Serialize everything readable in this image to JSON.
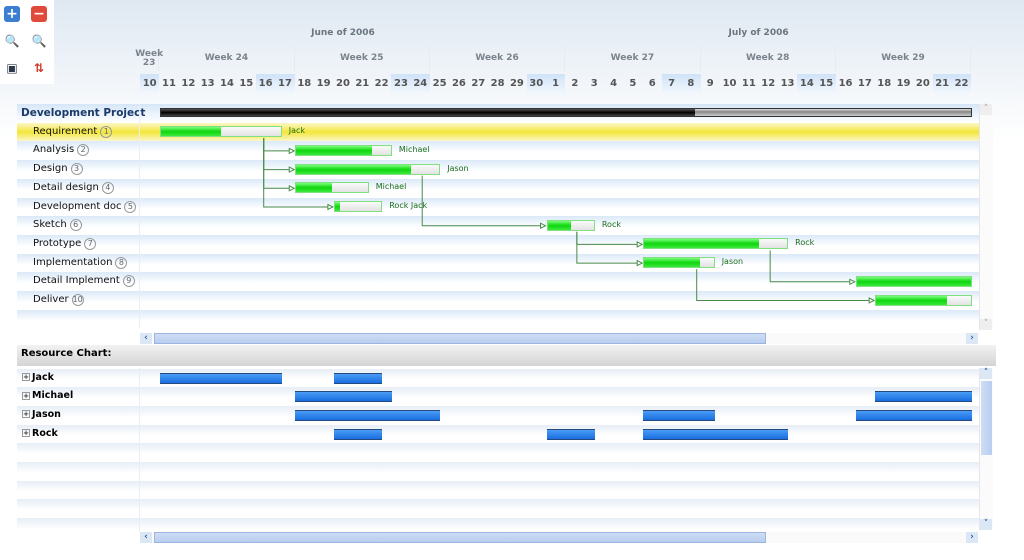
{
  "toolbar": [
    {
      "icon": "zoom-in-plus-icon",
      "glyph": "+",
      "color": "#3a7fd0"
    },
    {
      "icon": "minus-icon",
      "glyph": "−",
      "color": "#e04a3a"
    },
    {
      "icon": "magnifier-zoom-in-icon",
      "glyph": "🔍",
      "color": "#3aa058"
    },
    {
      "icon": "magnifier-zoom-out-icon",
      "glyph": "🔍",
      "color": "#c85a3a"
    },
    {
      "icon": "save-icon",
      "glyph": "▣",
      "color": "#2a3a4a"
    },
    {
      "icon": "sort-arrows-icon",
      "glyph": "⇅",
      "color": "#d03a2a"
    }
  ],
  "timeline": {
    "origin": "2006-06-10",
    "months": [
      {
        "label": "June of 2006",
        "days": 21
      },
      {
        "label": "July of 2006",
        "days": 22
      }
    ],
    "weeks": [
      {
        "label": "Week 23",
        "days": 1
      },
      {
        "label": "Week 24",
        "days": 7
      },
      {
        "label": "Week 25",
        "days": 7
      },
      {
        "label": "Week 26",
        "days": 7
      },
      {
        "label": "Week 27",
        "days": 7
      },
      {
        "label": "Week 28",
        "days": 7
      },
      {
        "label": "Week 29",
        "days": 7
      }
    ],
    "days": [
      "10",
      "11",
      "12",
      "13",
      "14",
      "15",
      "16",
      "17",
      "18",
      "19",
      "20",
      "21",
      "22",
      "23",
      "24",
      "25",
      "26",
      "27",
      "28",
      "29",
      "30",
      "1",
      "2",
      "3",
      "4",
      "5",
      "6",
      "7",
      "8",
      "9",
      "10",
      "11",
      "12",
      "13",
      "14",
      "15",
      "16",
      "17",
      "18",
      "19",
      "20",
      "21",
      "22"
    ],
    "weekend_days": [
      0,
      6,
      7,
      13,
      14,
      20,
      21,
      27,
      28,
      34,
      35,
      41,
      42
    ]
  },
  "project": {
    "name": "Development Project",
    "start": "2006-06-11",
    "end": "2006-07-23",
    "progress": 66
  },
  "tasks": [
    {
      "name": "Requirement",
      "num": "1",
      "start": "2006-06-11",
      "days": 6.3,
      "progress": 50,
      "resource": "Jack",
      "deps": [
        1,
        2,
        3,
        4
      ]
    },
    {
      "name": "Analysis",
      "num": "2",
      "start": "2006-06-18",
      "days": 5,
      "progress": 80,
      "resource": "Michael",
      "deps": []
    },
    {
      "name": "Design",
      "num": "3",
      "start": "2006-06-18",
      "days": 7.5,
      "progress": 80,
      "resource": "Jason",
      "deps": [
        5
      ]
    },
    {
      "name": "Detail design",
      "num": "4",
      "start": "2006-06-18",
      "days": 3.8,
      "progress": 50,
      "resource": "Michael",
      "deps": []
    },
    {
      "name": "Development doc",
      "num": "5",
      "start": "2006-06-20",
      "days": 2.5,
      "progress": 10,
      "resource": "Rock Jack",
      "deps": []
    },
    {
      "name": "Sketch",
      "num": "6",
      "start": "2006-07-01",
      "days": 2.5,
      "progress": 50,
      "resource": "Rock",
      "deps": [
        6,
        7
      ]
    },
    {
      "name": "Prototype",
      "num": "7",
      "start": "2006-07-06",
      "days": 7.5,
      "progress": 80,
      "resource": "Rock",
      "deps": [
        8
      ]
    },
    {
      "name": "Implementation",
      "num": "8",
      "start": "2006-07-06",
      "days": 3.7,
      "progress": 80,
      "resource": "Jason",
      "deps": [
        9
      ]
    },
    {
      "name": "Detail Implement",
      "num": "9",
      "start": "2006-07-17",
      "days": 6,
      "progress": 100,
      "resource": "",
      "deps": []
    },
    {
      "name": "Deliver",
      "num": "10",
      "start": "2006-07-18",
      "days": 5,
      "progress": 75,
      "resource": "",
      "deps": []
    }
  ],
  "resource_chart": {
    "title": "Resource Chart:",
    "resources": [
      {
        "name": "Jack",
        "bars": [
          [
            "2006-06-11",
            6.3
          ],
          [
            "2006-06-20",
            2.5
          ]
        ]
      },
      {
        "name": "Michael",
        "bars": [
          [
            "2006-06-18",
            5
          ],
          [
            "2006-07-18",
            5
          ]
        ]
      },
      {
        "name": "Jason",
        "bars": [
          [
            "2006-06-18",
            7.5
          ],
          [
            "2006-07-06",
            3.7
          ],
          [
            "2006-07-17",
            6
          ]
        ]
      },
      {
        "name": "Rock",
        "bars": [
          [
            "2006-06-20",
            2.5
          ],
          [
            "2006-07-01",
            2.5
          ],
          [
            "2006-07-06",
            7.5
          ]
        ]
      }
    ]
  },
  "colors": {
    "selected_row": "#f2e63a",
    "progress": "#0ed60e",
    "resource_bar": "#1a6fe0"
  }
}
